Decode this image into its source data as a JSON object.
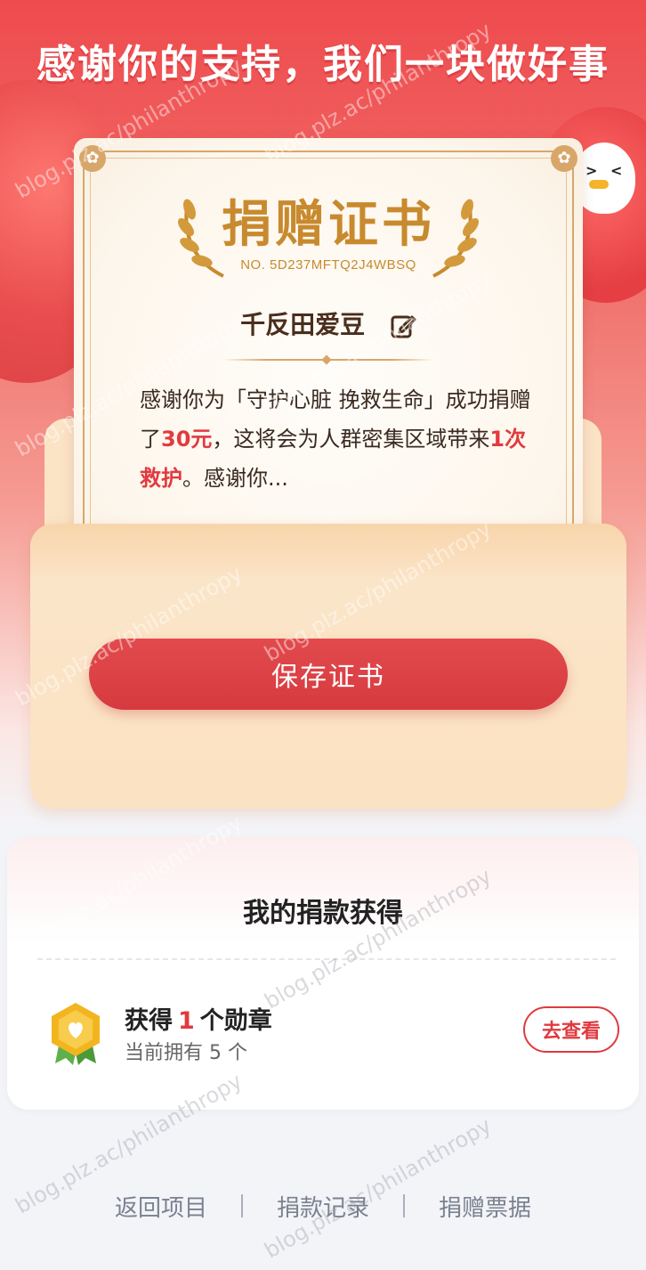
{
  "header": {
    "headline": "感谢你的支持，我们一块做好事"
  },
  "certificate": {
    "title": "捐赠证书",
    "number_label": "NO. 5D237MFTQ2J4WBSQ",
    "name": "千反田爱豆",
    "body_prefix": "感谢你为「守护心脏 挽救生命」成功捐赠了",
    "amount": "30元",
    "body_mid": "，这将会为人群密集区域带来",
    "rescue": "1次救护",
    "body_suffix": "。感谢你..."
  },
  "actions": {
    "save_label": "保存证书"
  },
  "rewards": {
    "title": "我的捐款获得",
    "got_prefix": "获得",
    "got_count": "1",
    "got_suffix": "个勋章",
    "owned_text": "当前拥有 5 个",
    "view_label": "去查看"
  },
  "footer": {
    "links": [
      "返回项目",
      "捐款记录",
      "捐赠票据"
    ]
  },
  "watermark": "blog.plz.ac/philanthropy",
  "colors": {
    "accent": "#e23a3f",
    "gold": "#c88a2e"
  }
}
